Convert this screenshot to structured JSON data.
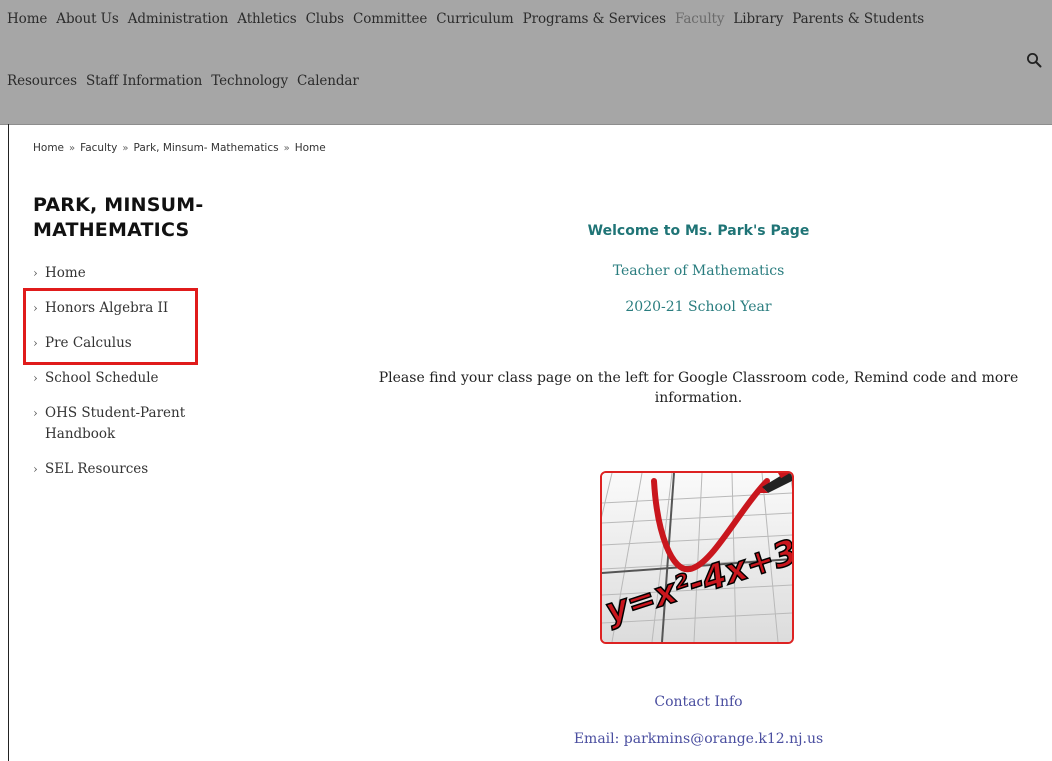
{
  "top_nav": {
    "row1": [
      {
        "label": "Home",
        "active": false
      },
      {
        "label": "About Us",
        "active": false
      },
      {
        "label": "Administration",
        "active": false
      },
      {
        "label": "Athletics",
        "active": false
      },
      {
        "label": "Clubs",
        "active": false
      },
      {
        "label": "Committee",
        "active": false
      },
      {
        "label": "Curriculum",
        "active": false
      },
      {
        "label": "Programs & Services",
        "active": false
      },
      {
        "label": "Faculty",
        "active": true
      },
      {
        "label": "Library",
        "active": false
      },
      {
        "label": "Parents & Students",
        "active": false
      }
    ],
    "row2": [
      {
        "label": "Resources",
        "active": false
      },
      {
        "label": "Staff Information",
        "active": false
      },
      {
        "label": "Technology",
        "active": false
      },
      {
        "label": "Calendar",
        "active": false
      }
    ],
    "search_icon": "search-icon"
  },
  "breadcrumb": {
    "items": [
      "Home",
      "Faculty",
      "Park, Minsum- Mathematics",
      "Home"
    ],
    "separator": "»"
  },
  "sidebar": {
    "title": "PARK, MINSUM-MATHEMATICS",
    "title_line1": "PARK, MINSUM-",
    "title_line2": "MATHEMATICS",
    "items": [
      {
        "label": "Home"
      },
      {
        "label": "Honors Algebra II"
      },
      {
        "label": "Pre Calculus"
      },
      {
        "label": "School Schedule"
      },
      {
        "label": "OHS Student-Parent Handbook"
      },
      {
        "label": "SEL Resources"
      }
    ],
    "chevron": "›",
    "highlight_color": "#e01b1b"
  },
  "main": {
    "welcome": "Welcome to Ms. Park's Page",
    "teacher": "Teacher of Mathematics",
    "year": "2020-21 School Year",
    "instructions": "Please find your class page on the left for Google Classroom code, Remind code and more information.",
    "image_equation": "y=x²-4x+3",
    "contact_heading": "Contact Info",
    "email": "Email: parkmins@orange.k12.nj.us"
  },
  "colors": {
    "nav_background": "#a6a6a6",
    "heading_teal": "#1f7476",
    "link_purple": "#4b4fa0"
  }
}
